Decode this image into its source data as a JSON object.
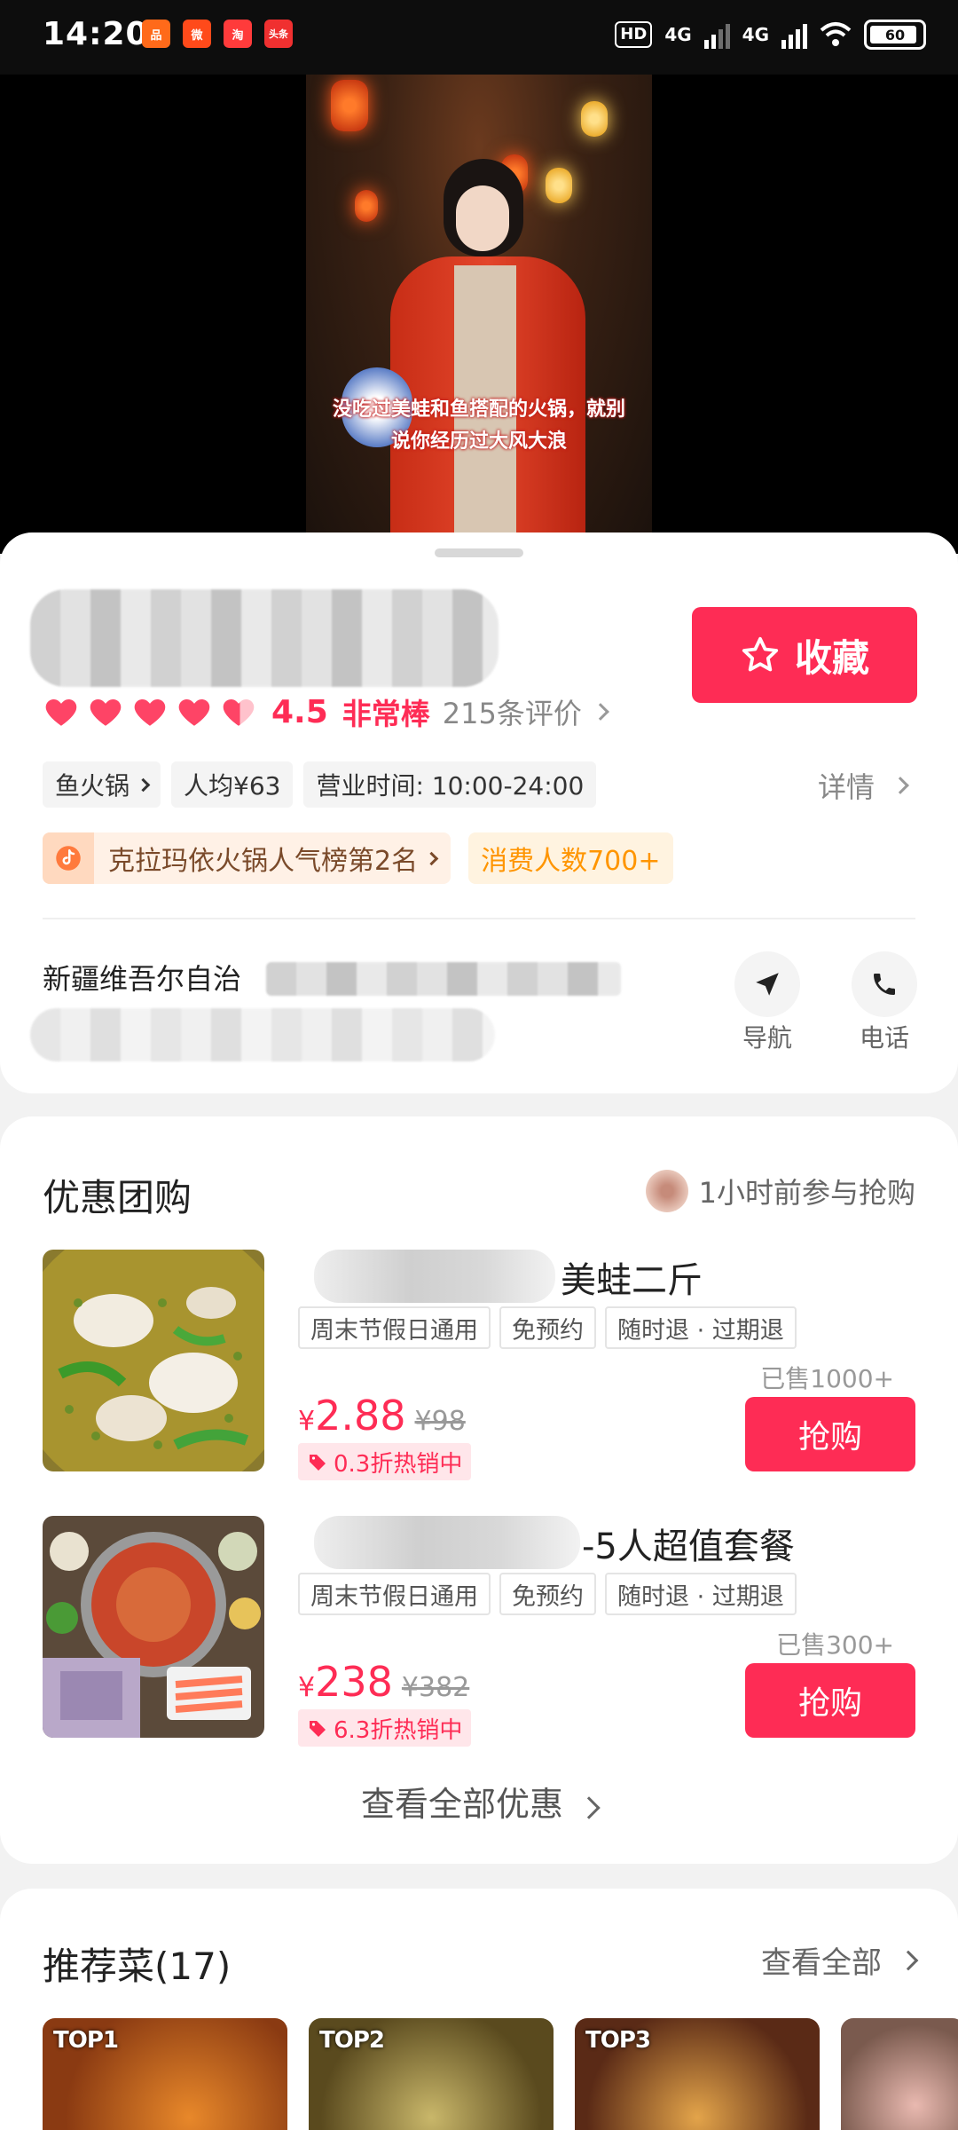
{
  "status_bar": {
    "time": "14:20",
    "app_icons": [
      {
        "name": "aux-app-icon",
        "color": "#ff6a1a",
        "glyph": "品"
      },
      {
        "name": "weibo-icon",
        "color": "#ff4a1a",
        "glyph": "微"
      },
      {
        "name": "taobao-icon",
        "color": "#ff3b3b",
        "glyph": "淘"
      },
      {
        "name": "toutiao-icon",
        "color": "#f03030",
        "glyph": "头条"
      }
    ],
    "hd_label": "HD",
    "network_1": "4G",
    "network_2": "4G",
    "battery": "60"
  },
  "video": {
    "caption": "没吃过美蛙和鱼搭配的火锅，就别说你经历过大风大浪"
  },
  "shop": {
    "favorite_label": "收藏",
    "rating_score": "4.5",
    "rating_text": "非常棒",
    "review_count": "215条评价",
    "tags": [
      "鱼火锅",
      "人均¥63",
      "营业时间: 10:00-24:00"
    ],
    "detail_label": "详情",
    "rank_label": "克拉玛依火锅人气榜第2名",
    "consumers_label": "消费人数700+",
    "address_prefix": "新疆维吾尔自治",
    "nav_label": "导航",
    "phone_label": "电话"
  },
  "deals": {
    "title": "优惠团购",
    "recent_activity": "1小时前参与抢购",
    "items": [
      {
        "name": "美蛙二斤",
        "tags": [
          "周末节假日通用",
          "免预约",
          "随时退 · 过期退"
        ],
        "sold": "已售1000+",
        "currency": "¥",
        "price": "2.88",
        "original_price": "¥98",
        "discount": "0.3折热销中",
        "buy_label": "抢购"
      },
      {
        "name": "-5人超值套餐",
        "tags": [
          "周末节假日通用",
          "免预约",
          "随时退 · 过期退"
        ],
        "sold": "已售300+",
        "currency": "¥",
        "price": "238",
        "original_price": "¥382",
        "discount": "6.3折热销中",
        "buy_label": "抢购"
      }
    ],
    "see_all_label": "查看全部优惠"
  },
  "recommended": {
    "title": "推荐菜(17)",
    "see_all_label": "查看全部",
    "dishes": [
      {
        "badge": "TOP1"
      },
      {
        "badge": "TOP2"
      },
      {
        "badge": "TOP3"
      },
      {
        "badge": ""
      }
    ]
  },
  "colors": {
    "accent": "#fe2c55",
    "orange": "#ff9500",
    "background": "#f2f2f2"
  }
}
